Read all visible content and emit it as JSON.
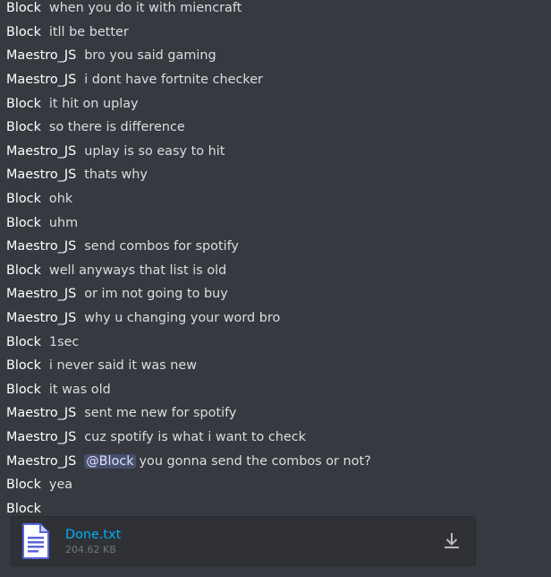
{
  "messages": [
    {
      "author": "Block",
      "text": "when you do it with miencraft"
    },
    {
      "author": "Block",
      "text": "itll be better"
    },
    {
      "author": "Maestro_JS",
      "text": "bro you said gaming"
    },
    {
      "author": "Maestro_JS",
      "text": "i dont have fortnite checker"
    },
    {
      "author": "Block",
      "text": "it hit on uplay"
    },
    {
      "author": "Block",
      "text": "so there is difference"
    },
    {
      "author": "Maestro_JS",
      "text": "uplay is so easy to hit"
    },
    {
      "author": "Maestro_JS",
      "text": "thats why"
    },
    {
      "author": "Block",
      "text": "ohk"
    },
    {
      "author": "Block",
      "text": "uhm"
    },
    {
      "author": "Maestro_JS",
      "text": "send combos for spotify"
    },
    {
      "author": "Block",
      "text": "well anyways that list is old"
    },
    {
      "author": "Maestro_JS",
      "text": "or im not going to buy"
    },
    {
      "author": "Maestro_JS",
      "text": "why u changing your word bro"
    },
    {
      "author": "Block",
      "text": "1sec"
    },
    {
      "author": "Block",
      "text": "i never said it was new"
    },
    {
      "author": "Block",
      "text": "it was old"
    },
    {
      "author": "Maestro_JS",
      "text": "sent me new for spotify"
    },
    {
      "author": "Maestro_JS",
      "text": "cuz spotify is what i want to check"
    },
    {
      "author": "Maestro_JS",
      "mention": "@Block",
      "text": "you gonna send the combos or not?"
    },
    {
      "author": "Block",
      "text": "yea"
    },
    {
      "author": "Block",
      "text": ""
    }
  ],
  "attachment": {
    "file_name": "Done.txt",
    "file_size": "204.62 KB",
    "icon": "text-file-icon",
    "action_icon": "download-icon"
  },
  "colors": {
    "background": "#36393f",
    "author": "#ffffff",
    "message_text": "#dcddde",
    "link": "#00b0f4",
    "attachment_bg": "#2f3136",
    "file_size": "#72767d",
    "mention_bg": "#5865a0"
  }
}
